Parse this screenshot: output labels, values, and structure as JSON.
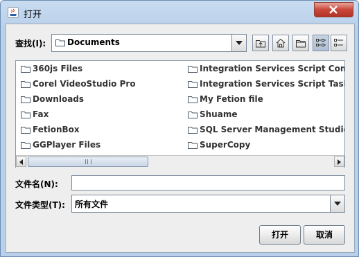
{
  "window": {
    "title": "打开"
  },
  "lookin": {
    "label": "查找(I):",
    "value": "Documents"
  },
  "toolbar": {
    "up": "up-one-level-icon",
    "home": "home-icon",
    "new_folder": "new-folder-icon",
    "list_view": "list-view-icon",
    "details_view": "details-view-icon"
  },
  "files": {
    "col1": [
      "360js Files",
      "Corel VideoStudio Pro",
      "Downloads",
      "Fax",
      "FetionBox",
      "GGPlayer Files"
    ],
    "col2": [
      "Integration Services Script Component",
      "Integration Services Script Task",
      "My Fetion file",
      "Shuame",
      "SQL Server Management Studio",
      "SuperCopy"
    ]
  },
  "filename": {
    "label": "文件名(N):",
    "value": ""
  },
  "filetype": {
    "label": "文件类型(T):",
    "value": "所有文件"
  },
  "buttons": {
    "open": "打开",
    "cancel": "取消"
  }
}
